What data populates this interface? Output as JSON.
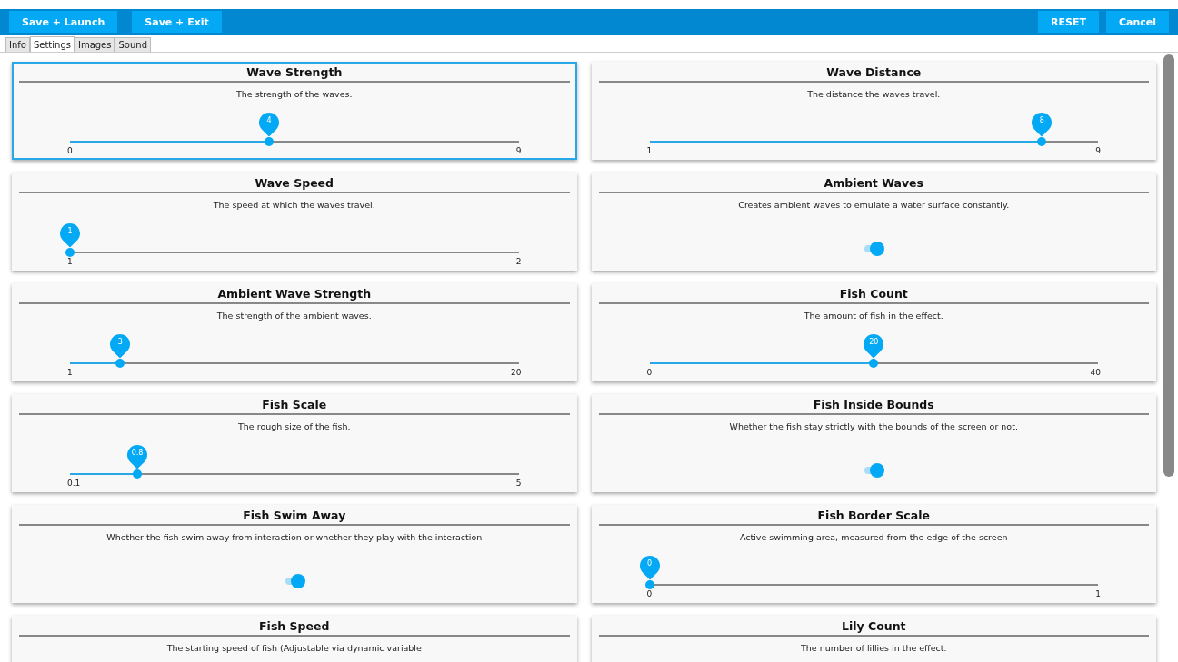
{
  "toolbar": {
    "left_buttons": [
      "Save + Launch",
      "Save + Exit"
    ],
    "right_buttons": [
      "RESET",
      "Cancel"
    ]
  },
  "tabs": [
    {
      "label": "Info",
      "selected": false
    },
    {
      "label": "Settings",
      "selected": true
    },
    {
      "label": "Images",
      "selected": false
    },
    {
      "label": "Sound",
      "selected": false
    }
  ],
  "settings": [
    {
      "title": "Wave Strength",
      "description": "The strength of the waves.",
      "selected": true,
      "control": {
        "kind": "slider",
        "value": "4",
        "min": "0",
        "max": "9",
        "level": 0.444
      }
    },
    {
      "title": "Wave Distance",
      "description": "The distance the waves travel.",
      "selected": false,
      "control": {
        "kind": "slider",
        "value": "8",
        "min": "1",
        "max": "9",
        "level": 0.875
      }
    },
    {
      "title": "Wave Speed",
      "description": "The speed at which the waves travel.",
      "selected": false,
      "control": {
        "kind": "slider",
        "value": "1",
        "min": "1",
        "max": "2",
        "level": 0
      }
    },
    {
      "title": "Ambient Waves",
      "description": "Creates ambient waves to emulate a water surface constantly.",
      "selected": false,
      "control": {
        "kind": "toggle",
        "on": true
      }
    },
    {
      "title": "Ambient Wave Strength",
      "description": "The strength of the ambient waves.",
      "selected": false,
      "control": {
        "kind": "slider",
        "value": "3",
        "min": "1",
        "max": "20",
        "level": 0.112
      }
    },
    {
      "title": "Fish Count",
      "description": "The amount of fish in the effect.",
      "selected": false,
      "control": {
        "kind": "slider",
        "value": "20",
        "min": "0",
        "max": "40",
        "level": 0.5
      }
    },
    {
      "title": "Fish Scale",
      "description": "The rough size of the fish.",
      "selected": false,
      "control": {
        "kind": "slider",
        "value": "0.8",
        "min": "0.1",
        "max": "5",
        "level": 0.15
      }
    },
    {
      "title": "Fish Inside Bounds",
      "description": "Whether the fish stay strictly with the bounds of the screen or not.",
      "selected": false,
      "control": {
        "kind": "toggle",
        "on": true
      }
    },
    {
      "title": "Fish Swim Away",
      "description": "Whether the fish swim away from interaction or whether they play with the interaction",
      "selected": false,
      "control": {
        "kind": "toggle",
        "on": true
      }
    },
    {
      "title": "Fish Border Scale",
      "description": "Active swimming area, measured from the edge of the screen",
      "selected": false,
      "control": {
        "kind": "slider",
        "value": "0",
        "min": "0",
        "max": "1",
        "level": 0
      }
    },
    {
      "title": "Fish Speed",
      "description": "The starting speed of fish (Adjustable via dynamic variable",
      "selected": false
    },
    {
      "title": "Lily Count",
      "description": "The number of lillies in the effect.",
      "selected": false
    }
  ]
}
